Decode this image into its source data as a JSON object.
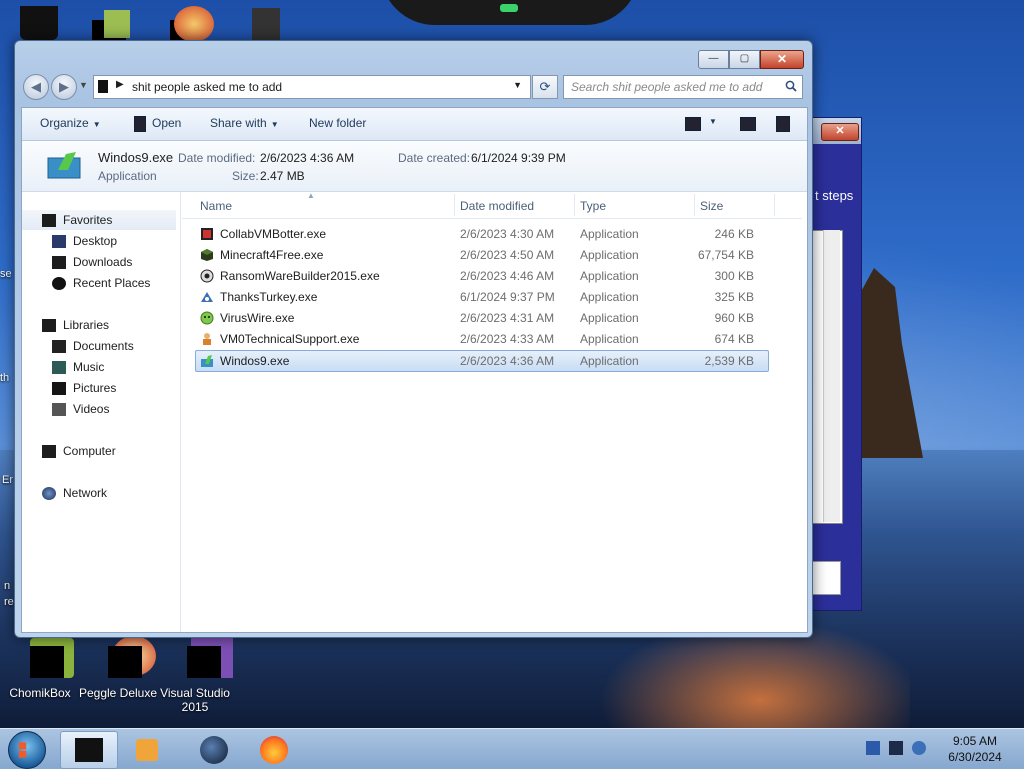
{
  "desktop": {
    "icons": [
      {
        "label": "ChomikBox"
      },
      {
        "label": "Peggle Deluxe"
      },
      {
        "label": "Visual Studio 2015"
      }
    ],
    "partial_texts": {
      "left_1": "se",
      "left_2": "th",
      "left_3": "Er",
      "left_4": "n",
      "left_5": "re"
    }
  },
  "background_dialog": {
    "close_label": "✕",
    "text_fragment": "t steps"
  },
  "explorer": {
    "caption_buttons": {
      "minimize": "—",
      "maximize": "▢",
      "close": "✕"
    },
    "address": {
      "path": "shit people asked me to add"
    },
    "search": {
      "placeholder": "Search shit people asked me to add"
    },
    "toolbar": {
      "organize": "Organize",
      "open": "Open",
      "share_with": "Share with",
      "new_folder": "New folder"
    },
    "details": {
      "name": "Windos9.exe",
      "type": "Application",
      "date_modified_label": "Date modified:",
      "date_modified": "2/6/2023 4:36 AM",
      "date_created_label": "Date created:",
      "date_created": "6/1/2024 9:39 PM",
      "size_label": "Size:",
      "size": "2.47 MB"
    },
    "nav": {
      "favorites": "Favorites",
      "desktop": "Desktop",
      "downloads": "Downloads",
      "recent": "Recent Places",
      "libraries": "Libraries",
      "documents": "Documents",
      "music": "Music",
      "pictures": "Pictures",
      "videos": "Videos",
      "computer": "Computer",
      "network": "Network"
    },
    "columns": {
      "name": "Name",
      "date": "Date modified",
      "type": "Type",
      "size": "Size"
    },
    "files": [
      {
        "name": "CollabVMBotter.exe",
        "date": "2/6/2023 4:30 AM",
        "type": "Application",
        "size": "246 KB"
      },
      {
        "name": "Minecraft4Free.exe",
        "date": "2/6/2023 4:50 AM",
        "type": "Application",
        "size": "67,754 KB"
      },
      {
        "name": "RansomWareBuilder2015.exe",
        "date": "2/6/2023 4:46 AM",
        "type": "Application",
        "size": "300 KB"
      },
      {
        "name": "ThanksTurkey.exe",
        "date": "6/1/2024 9:37 PM",
        "type": "Application",
        "size": "325 KB"
      },
      {
        "name": "VirusWire.exe",
        "date": "2/6/2023 4:31 AM",
        "type": "Application",
        "size": "960 KB"
      },
      {
        "name": "VM0TechnicalSupport.exe",
        "date": "2/6/2023 4:33 AM",
        "type": "Application",
        "size": "674 KB"
      },
      {
        "name": "Windos9.exe",
        "date": "2/6/2023 4:36 AM",
        "type": "Application",
        "size": "2,539 KB",
        "selected": true
      }
    ]
  },
  "taskbar": {
    "clock": {
      "time": "9:05 AM",
      "date": "6/30/2024"
    }
  },
  "colors": {
    "accent": "#3399ff",
    "selection": "#cce4f7",
    "close_red": "#c5432a"
  }
}
